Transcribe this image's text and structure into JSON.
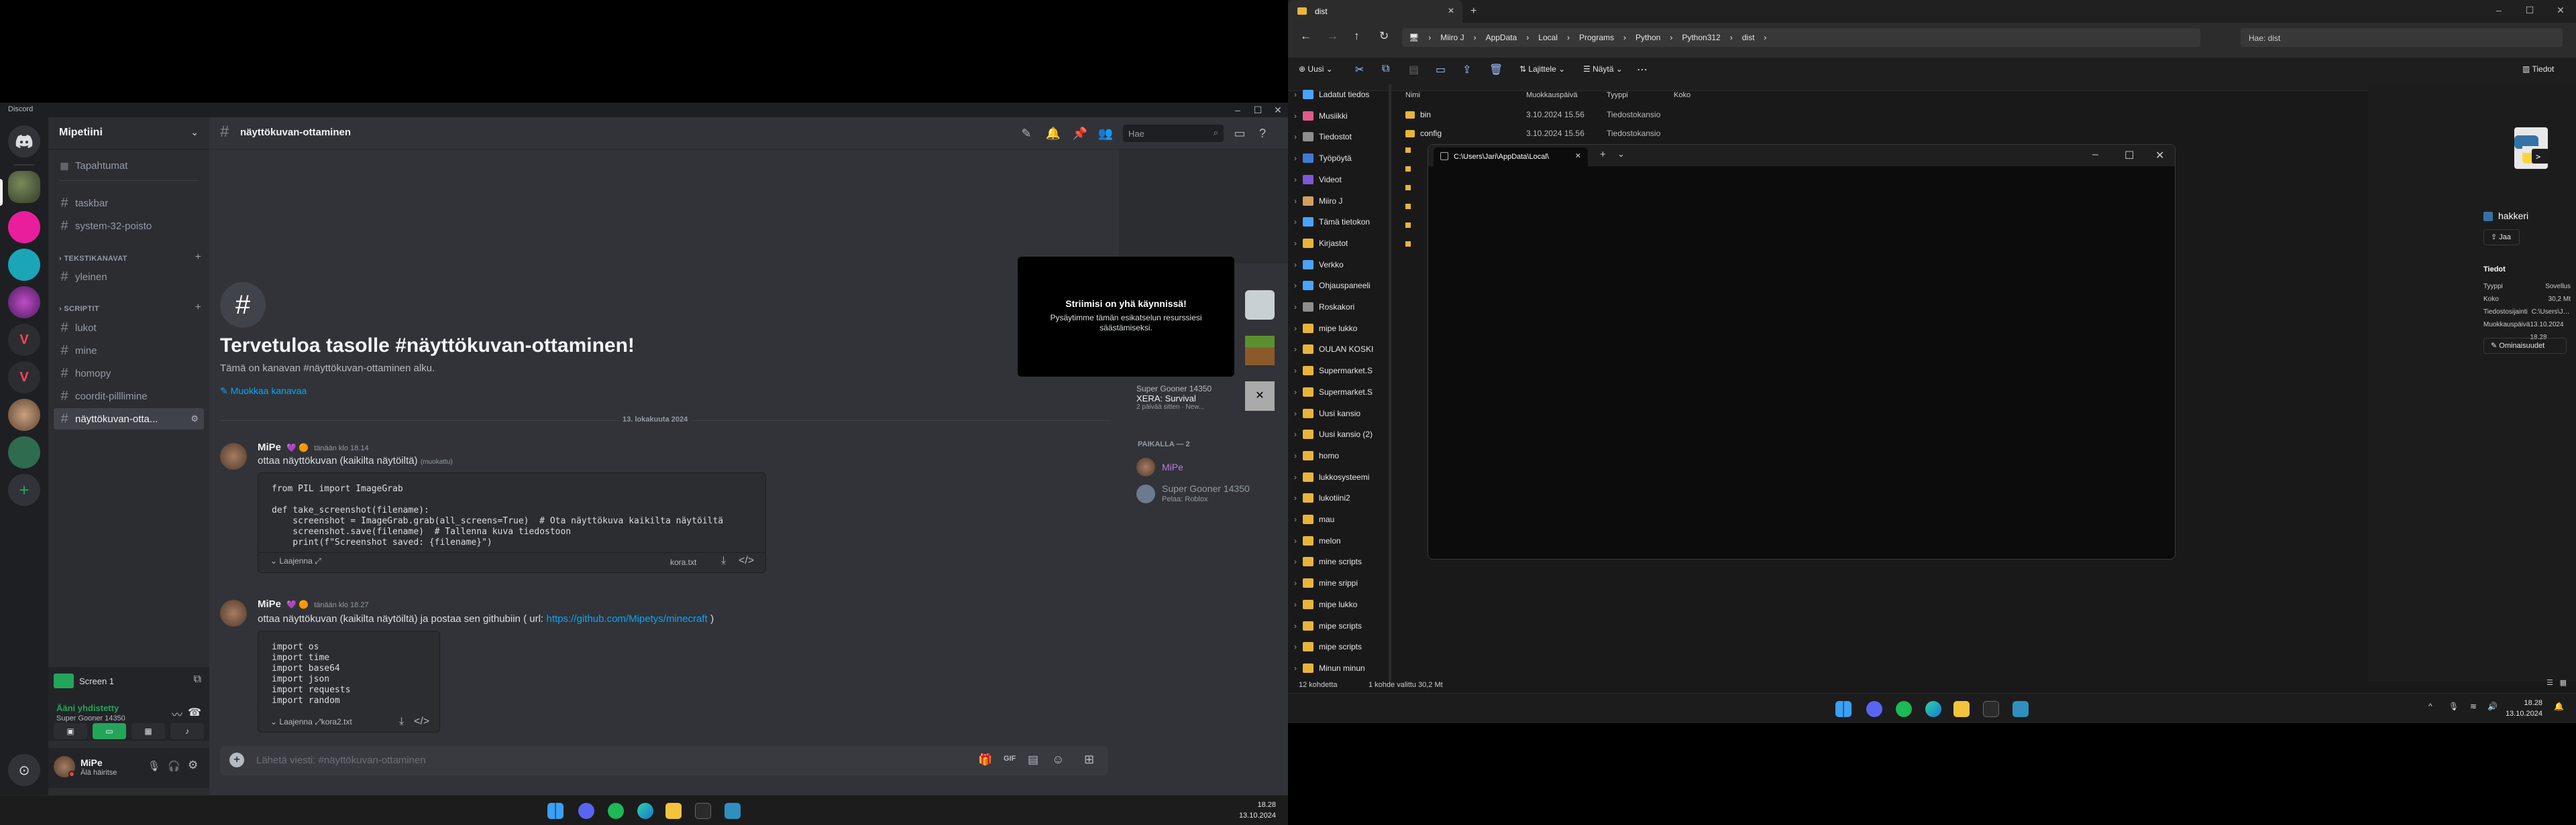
{
  "discord": {
    "app_name": "Discord",
    "server_name": "Mipetiini",
    "events_label": "Tapahtumat",
    "channels_top": [
      {
        "name": "taskbar"
      },
      {
        "name": "system-32-poisto"
      }
    ],
    "categories": {
      "text": "TEKSTIKANAVAT",
      "scripts": "SCRIPTIT"
    },
    "text_channels": [
      {
        "name": "yleinen"
      }
    ],
    "script_channels": [
      {
        "name": "lukot"
      },
      {
        "name": "mine"
      },
      {
        "name": "homopy"
      },
      {
        "name": "coordit-pilllimine"
      },
      {
        "name": "näyttökuvan-otta..."
      }
    ],
    "screen_share": "Screen 1",
    "voice_status": "Ääni yhdistetty",
    "voice_channel": "Super Gooner 14350",
    "user": {
      "name": "MiPe",
      "status": "Älä häiritse"
    },
    "header_channel": "näyttökuvan-ottaminen",
    "search_placeholder": "Hae",
    "welcome_title": "Tervetuloa tasolle #näyttökuvan-ottaminen!",
    "welcome_sub": "Tämä on kanavan #näyttökuvan-ottaminen alku.",
    "edit_channel": "Muokkaa kanavaa",
    "date_divider": "13. lokakuuta 2024",
    "messages": [
      {
        "author": "MiPe",
        "time": "tänään klo 18.14",
        "text": "ottaa näyttökuvan (kaikilta näytöiltä)",
        "edited": "(muokattu)",
        "code": "from PIL import ImageGrab\n\ndef take_screenshot(filename):\n    screenshot = ImageGrab.grab(all_screens=True)  # Ota näyttökuva kaikilta näytöiltä\n    screenshot.save(filename)  # Tallenna kuva tiedostoon\n    print(f\"Screenshot saved: {filename}\")",
        "expand": "Laajenna",
        "file": "kora.txt"
      },
      {
        "author": "MiPe",
        "time": "tänään klo 18.27",
        "text": "ottaa näyttökuvan (kaikilta näytöiltä) ja postaa sen githubiin ( url:",
        "link": "https://github.com/Mipetys/minecraft",
        "text_after": ")",
        "code": "import os\nimport time\nimport base64\nimport json\nimport requests\nimport random",
        "expand": "Laajenna",
        "file": "kora2.txt"
      }
    ],
    "composer_placeholder": "Lähetä viesti: #näyttökuvan-ottaminen",
    "stream_notice": {
      "title": "Striimisi on yhä käynnissä!",
      "body": "Pysäytimme tämän esikatselun resurssiesi säästämiseksi."
    },
    "activity": {
      "user": "Super Gooner 14350",
      "game": "XERA: Survival",
      "ago": "2 päivää sitten",
      "extra": "New..."
    },
    "members_header": "PAIKALLA — 2",
    "members": [
      {
        "name": "MiPe",
        "status": ""
      },
      {
        "name": "Super Gooner 14350",
        "status": "Pelaa: Roblox"
      }
    ],
    "colors": {
      "bg": "#313338",
      "sidebar": "#2b2d31",
      "accent": "#5865f2",
      "link": "#00a8fc",
      "online": "#23a559"
    }
  },
  "taskbar_left": {
    "time": "18.28",
    "date": "13.10.2024"
  },
  "explorer": {
    "tab_title": "dist",
    "breadcrumb": [
      "Miiro J",
      "AppData",
      "Local",
      "Programs",
      "Python",
      "Python312",
      "dist"
    ],
    "search_placeholder": "Hae: dist",
    "toolbar": {
      "new": "Uusi",
      "sort": "Lajittele",
      "view": "Näytä",
      "details": "Tiedot"
    },
    "nav": [
      "Ladatut tiedos",
      "Musiikki",
      "Tiedostot",
      "Työpöytä",
      "Videot",
      "Miiro J",
      "Tämä tietokon",
      "Kirjastot",
      "Verkko",
      "Ohjauspaneeli",
      "Roskakori",
      "mipe lukko",
      "OULAN KOSKI",
      "Supermarket.S",
      "Supermarket.S",
      "Uusi kansio",
      "Uusi kansio (2)",
      "homo",
      "lukkosysteemi",
      "lukotiini2",
      "mau",
      "melon",
      "mine scripts",
      "mine srippi",
      "mipe lukko",
      "mipe scripts",
      "mipe scripts",
      "Minun minun"
    ],
    "columns": [
      "Nimi",
      "Muokkauspäivä",
      "Tyyppi",
      "Koko"
    ],
    "files": [
      {
        "name": "bin",
        "date": "3.10.2024 15.56",
        "type": "Tiedostokansio",
        "size": ""
      },
      {
        "name": "config",
        "date": "3.10.2024 15.56",
        "type": "Tiedostokansio",
        "size": ""
      }
    ],
    "status_left": "12 kohdetta",
    "status_selected": "1 kohde valittu 30,2 Mt",
    "details": {
      "name": "hakkeri",
      "share": "Jaa",
      "section": "Tiedot",
      "rows": [
        {
          "k": "Tyyppi",
          "v": "Sovellus"
        },
        {
          "k": "Koko",
          "v": "30,2 Mt"
        },
        {
          "k": "Tiedostosijainti",
          "v": "C:\\Users\\Jari\\AppData\\Local\\..."
        },
        {
          "k": "Muokkauspäivä",
          "v": "13.10.2024 18.28"
        }
      ],
      "properties": "Ominaisuudet"
    }
  },
  "terminal": {
    "tab": "C:\\Users\\Jari\\AppData\\Local\\"
  },
  "taskbar_right": {
    "time": "18.28",
    "date": "13.10.2024"
  }
}
